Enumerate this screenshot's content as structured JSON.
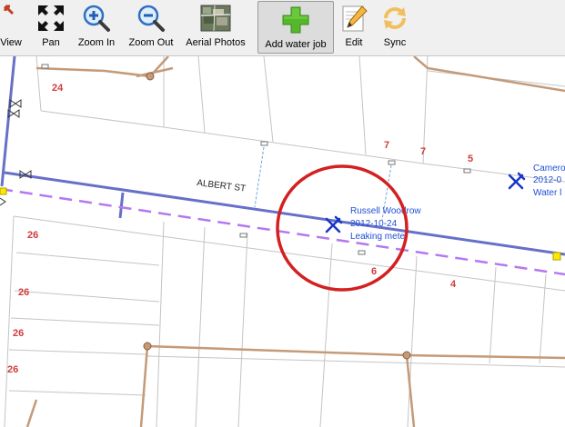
{
  "toolbar": {
    "buttons": [
      {
        "id": "zoom-full-view",
        "label": "t View",
        "icon": "zoom-full-view-icon"
      },
      {
        "id": "pan",
        "label": "Pan",
        "icon": "pan-arrows-icon"
      },
      {
        "id": "zoom-in",
        "label": "Zoom In",
        "icon": "magnifier-plus-icon"
      },
      {
        "id": "zoom-out",
        "label": "Zoom Out",
        "icon": "magnifier-minus-icon"
      },
      {
        "id": "aerial-photos",
        "label": "Aerial Photos",
        "icon": "aerial-photo-thumbnail-icon"
      },
      {
        "id": "add-water-job",
        "label": "Add water job",
        "icon": "green-plus-icon",
        "active": true
      },
      {
        "id": "edit",
        "label": "Edit",
        "icon": "pencil-icon"
      },
      {
        "id": "sync",
        "label": "Sync",
        "icon": "sync-arrows-icon"
      }
    ]
  },
  "map": {
    "street_name": "ALBERT ST",
    "lot_numbers": [
      "24",
      "7",
      "7",
      "5",
      "26",
      "26",
      "26",
      "26",
      "6",
      "4"
    ],
    "job_1": {
      "line1": "Russell Woodrow",
      "line2": "2012-10-24",
      "line3": "Leaking mete"
    },
    "job_2": {
      "line1": "Camero",
      "line2": "2012-0",
      "line3": "Water l"
    },
    "colors": {
      "water_main": "#6670c8",
      "proposed_line": "#b478f0",
      "sewer": "#c49a78",
      "lot_number": "#d03c3c",
      "job_text": "#1f4fd6",
      "highlight_circle": "#d42020",
      "hydrant": "#ffe800"
    }
  }
}
